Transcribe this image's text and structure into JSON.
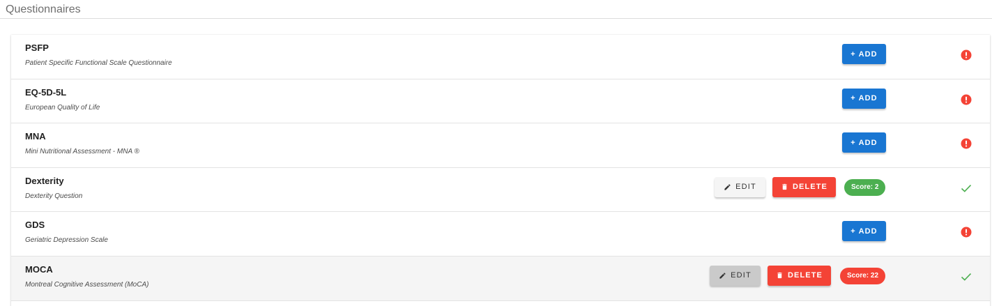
{
  "section": {
    "title": "Questionnaires"
  },
  "colors": {
    "add": "#1976d2",
    "delete": "#f44336",
    "score_good": "#4caf50",
    "score_bad": "#f44336",
    "status_incomplete": "#f44336",
    "status_complete": "#4caf50"
  },
  "questionnaires": [
    {
      "name": "PSFP",
      "description": "Patient Specific Functional Scale Questionnaire",
      "completed": false,
      "add_label": "+ ADD",
      "status_icon": "alert-circle-icon"
    },
    {
      "name": "EQ-5D-5L",
      "description": "European Quality of Life",
      "completed": false,
      "add_label": "+ ADD",
      "status_icon": "alert-circle-icon"
    },
    {
      "name": "MNA",
      "description": "Mini Nutritional Assessment - MNA ®",
      "completed": false,
      "add_label": "+ ADD",
      "status_icon": "alert-circle-icon"
    },
    {
      "name": "Dexterity",
      "description": "Dexterity Question",
      "completed": true,
      "edit_label": "EDIT",
      "delete_label": "DELETE",
      "score_label": "Score: 2",
      "score_color": "#4caf50",
      "status_icon": "check-icon"
    },
    {
      "name": "GDS",
      "description": "Geriatric Depression Scale",
      "completed": false,
      "add_label": "+ ADD",
      "status_icon": "alert-circle-icon"
    },
    {
      "name": "MOCA",
      "description": "Montreal Cognitive Assessment (MoCA)",
      "completed": true,
      "highlighted": true,
      "edit_label": "EDIT",
      "delete_label": "DELETE",
      "score_label": "Score: 22",
      "score_color": "#f44336",
      "status_icon": "check-icon"
    }
  ]
}
